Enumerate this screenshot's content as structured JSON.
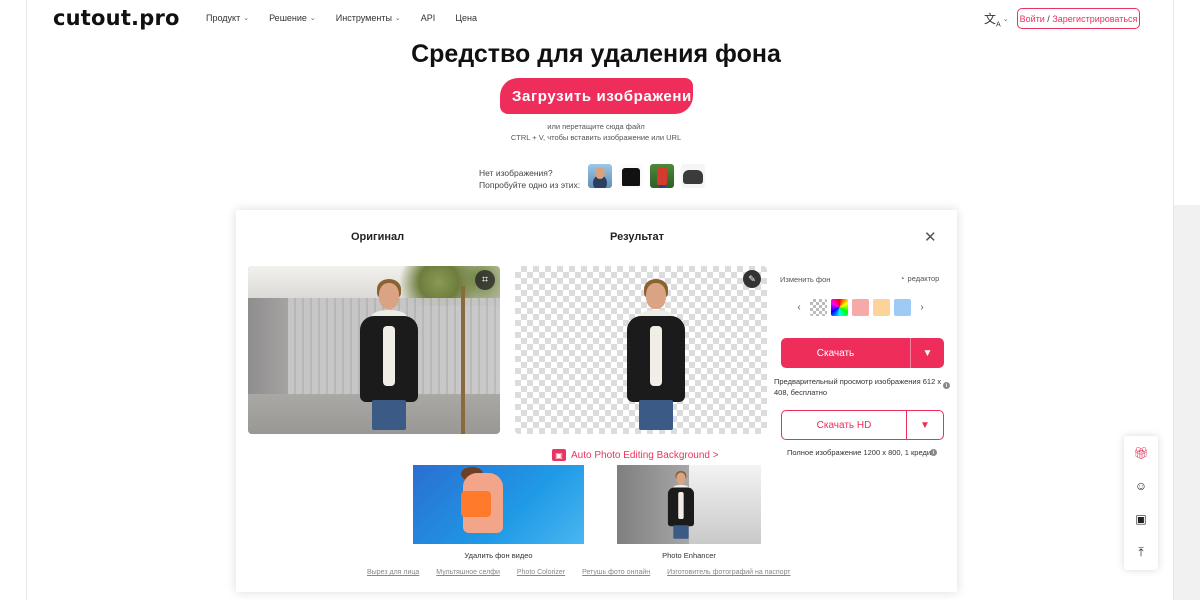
{
  "header": {
    "logo": "cutout.pro",
    "nav": [
      {
        "label": "Продукт",
        "has_dropdown": true
      },
      {
        "label": "Решение",
        "has_dropdown": true
      },
      {
        "label": "Инструменты",
        "has_dropdown": true
      },
      {
        "label": "API",
        "has_dropdown": false
      },
      {
        "label": "Цена",
        "has_dropdown": false
      }
    ],
    "lang_icon": "translate-icon",
    "auth": {
      "login": "Войти",
      "sep": "/",
      "register": "Зарегистрироваться"
    }
  },
  "hero": {
    "title": "Средство для удаления фона",
    "upload_button": "Загрузить изображени",
    "hint_drop": "или перетащите сюда файл",
    "hint_paste": "CTRL + V, чтобы вставить изображение или URL",
    "no_image_line1": "Нет изображения?",
    "no_image_line2": "Попробуйте одно из этих:"
  },
  "card": {
    "original_title": "Оригинал",
    "result_title": "Результат",
    "change_bg": "Изменить фон",
    "editor": "редактор",
    "swatch_colors": [
      "#f7a8a8",
      "#fcd49a",
      "#9ecbf5"
    ],
    "download": "Скачать",
    "preview_note": "Предварительный просмотр изображения 612 x 408, бесплатно",
    "download_hd": "Скачать HD",
    "full_note": "Полное изображение 1200 x 800, 1 кредит",
    "auto_link": "Auto Photo Editing Background >",
    "promos": [
      {
        "caption": "Удалить фон видео"
      },
      {
        "caption": "Photo Enhancer"
      }
    ],
    "footer_links": [
      "Вырез для лица",
      "Мультяшное селфи",
      "Photo Colorizer",
      "Ретушь фото онлайн",
      "Изготовитель фотографий на паспорт"
    ]
  },
  "colors": {
    "accent": "#ef2d5b"
  },
  "sidebar": [
    "gift-icon",
    "avatar-icon",
    "feedback-icon",
    "scroll-top-icon"
  ]
}
